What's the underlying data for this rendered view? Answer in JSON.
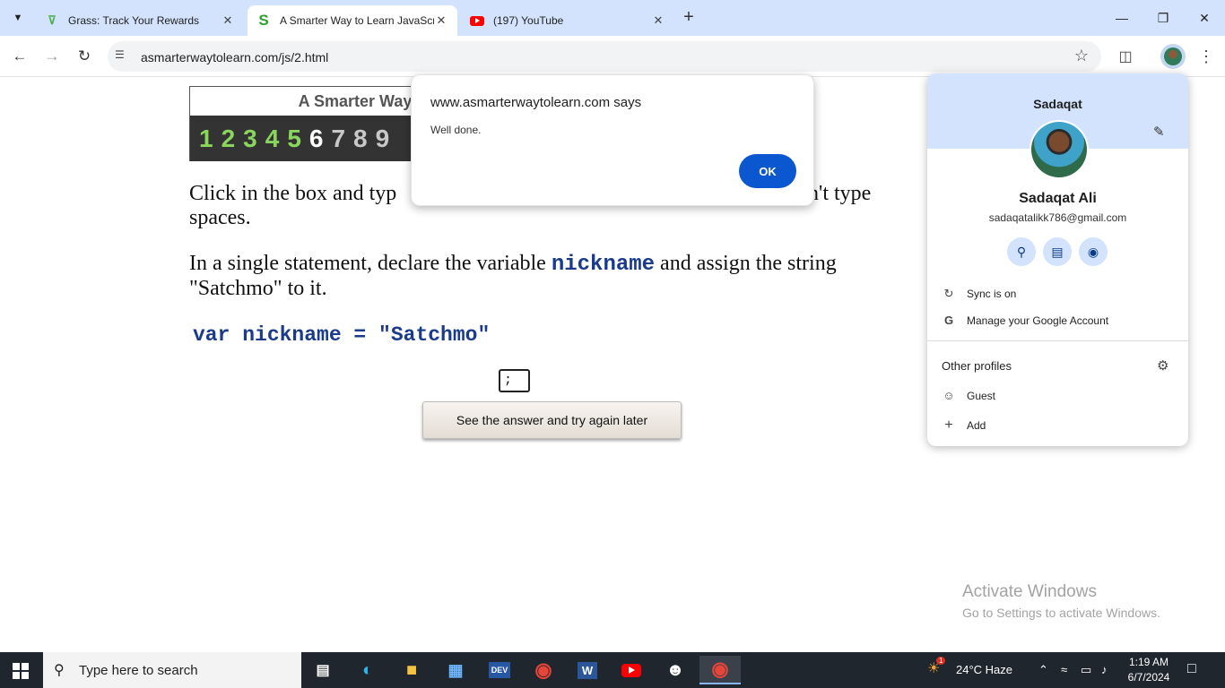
{
  "browser": {
    "tabs": [
      {
        "title": "Grass: Track Your Rewards",
        "favicon": "grass-icon",
        "color": "#4caf50"
      },
      {
        "title": "A Smarter Way to Learn JavaScript",
        "favicon": "s-logo-icon",
        "color": "#2e9e2e"
      },
      {
        "title": "(197) YouTube",
        "favicon": "youtube-icon",
        "color": "#ff0000"
      }
    ],
    "url": "asmarterwaytolearn.com/js/2.html"
  },
  "page": {
    "banner_title": "A Smarter Way",
    "progress_digits": [
      "1",
      "2",
      "3",
      "4",
      "5",
      "6",
      "7",
      "8",
      "9"
    ],
    "current_digit_index": 5,
    "instruction_line1": "Click in the box and typ",
    "instruction_tail": "n't type",
    "instruction_line2": "spaces.",
    "task_prefix": "In a single statement, declare the variable ",
    "task_var": "nickname",
    "task_suffix": " and assign the string",
    "task_line2": "\"Satchmo\" to it.",
    "code": "var nickname = \"Satchmo\"",
    "answer_value": ";",
    "answer_button": "See the answer and try again later"
  },
  "alert": {
    "title": "www.asmarterwaytolearn.com says",
    "message": "Well done.",
    "ok_label": "OK"
  },
  "profile": {
    "header_name": "Sadaqat",
    "full_name": "Sadaqat Ali",
    "email": "sadaqatalikk786@gmail.com",
    "sync": "Sync is on",
    "manage": "Manage your Google Account",
    "other_profiles": "Other profiles",
    "guest": "Guest",
    "add": "Add"
  },
  "watermark": {
    "line1": "Activate Windows",
    "line2": "Go to Settings to activate Windows."
  },
  "taskbar": {
    "search_placeholder": "Type here to search",
    "weather": "24°C  Haze",
    "weather_badge": "1",
    "time": "1:19 AM",
    "date": "6/7/2024"
  }
}
